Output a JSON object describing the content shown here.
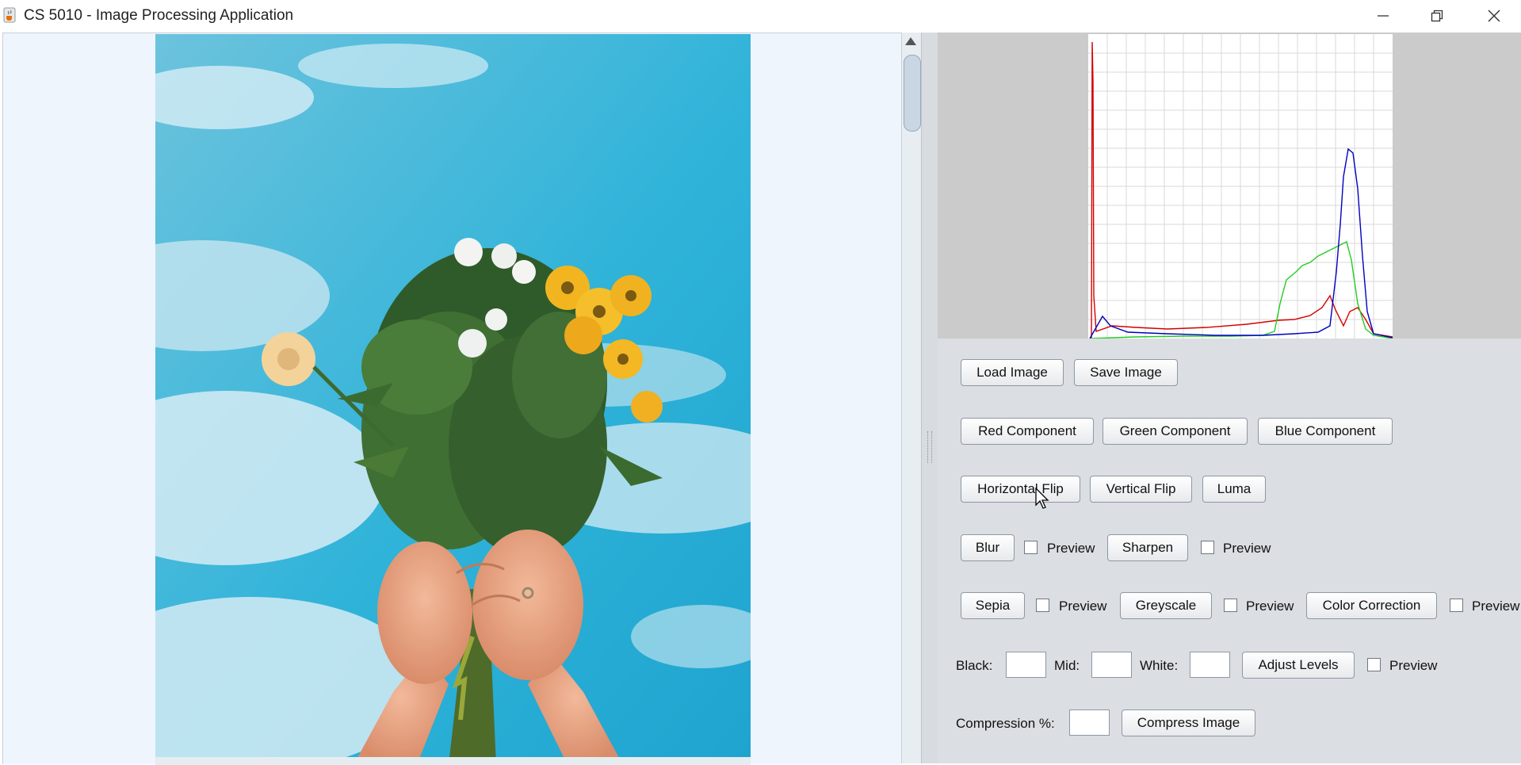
{
  "window": {
    "title": "CS 5010 - Image Processing Application",
    "app_icon": "java-cup-icon",
    "controls": [
      "minimize-icon",
      "restore-icon",
      "close-icon"
    ]
  },
  "image_view": {
    "image": "flower-bouquet-photo",
    "scrollbar": "vertical"
  },
  "histogram": {
    "series": [
      {
        "name": "red",
        "color": "#d40000"
      },
      {
        "name": "green",
        "color": "#22cc22"
      },
      {
        "name": "blue",
        "color": "#0000c0"
      }
    ]
  },
  "controls": {
    "load_image": "Load Image",
    "save_image": "Save Image",
    "red_component": "Red Component",
    "green_component": "Green Component",
    "blue_component": "Blue Component",
    "horizontal_flip": "Horizontal Flip",
    "vertical_flip": "Vertical Flip",
    "luma": "Luma",
    "blur": "Blur",
    "sharpen": "Sharpen",
    "sepia": "Sepia",
    "greyscale": "Greyscale",
    "color_correction": "Color Correction",
    "preview": "Preview",
    "black_label": "Black:",
    "mid_label": "Mid:",
    "white_label": "White:",
    "adjust_levels": "Adjust Levels",
    "compression_label": "Compression %:",
    "compress_image": "Compress Image",
    "black_value": "",
    "mid_value": "",
    "white_value": "",
    "compression_value": ""
  }
}
